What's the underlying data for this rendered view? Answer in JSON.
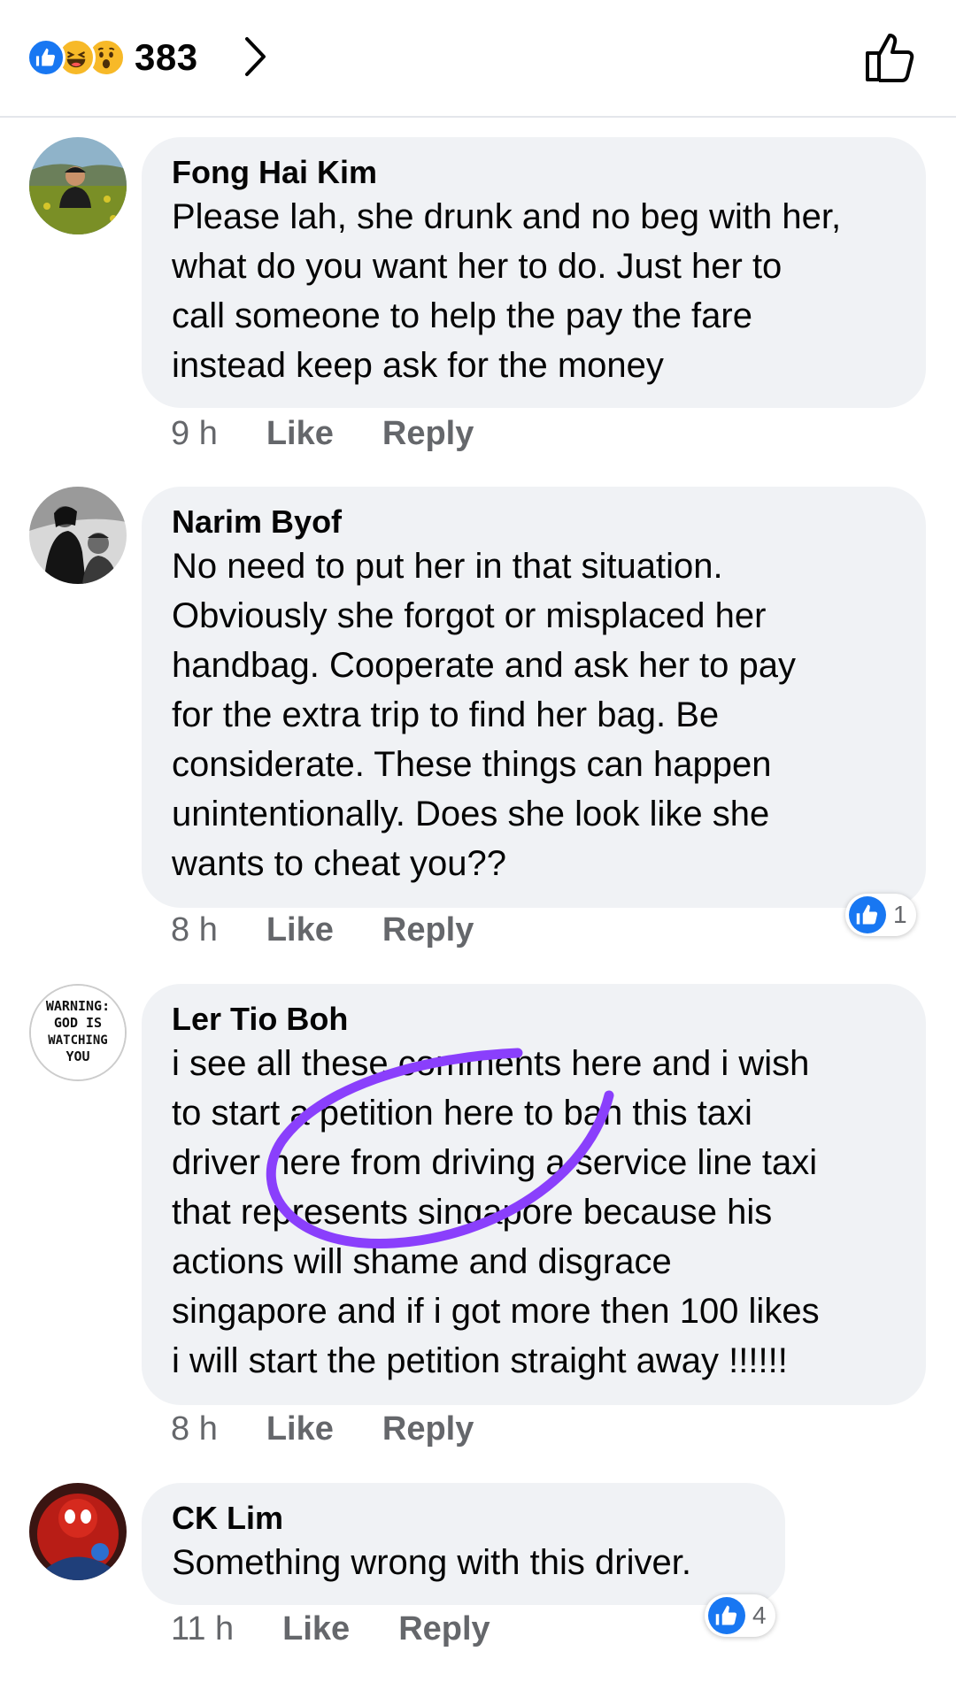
{
  "header": {
    "reaction_icons": [
      "like-reaction-icon",
      "haha-reaction-icon",
      "wow-reaction-icon"
    ],
    "reaction_count": "383"
  },
  "colors": {
    "like_blue": "#1877f2",
    "bubble_bg": "#f0f2f5",
    "meta_gray": "#65676b",
    "scribble_purple": "#8a3ffc"
  },
  "comments": [
    {
      "author": "Fong Hai Kim",
      "lines": [
        "Please lah, she drunk and no beg with her,",
        "what do you want her to do. Just her to",
        "call someone to help the pay the fare",
        "instead keep ask for the money"
      ],
      "time": "9 h",
      "like": "Like",
      "reply": "Reply"
    },
    {
      "author": "Narim Byof",
      "lines": [
        "No need to put her in that situation.",
        "Obviously she forgot or misplaced her",
        "handbag. Cooperate and ask her to pay",
        "for the extra trip to find her bag. Be",
        "considerate. These things can happen",
        "unintentionally. Does she look like she",
        "wants to cheat you??"
      ],
      "time": "8 h",
      "like": "Like",
      "reply": "Reply",
      "reaction_count": "1"
    },
    {
      "author": "Ler Tio Boh",
      "avatar_text": [
        "WARNING:",
        "GOD IS",
        "WATCHING",
        "YOU"
      ],
      "lines": [
        "i see all these comments here and i wish",
        "to start a petition here to ban this taxi",
        "driver here from driving a service line taxi",
        "that represents singapore because his",
        "actions will shame and disgrace",
        "singapore and if i got more then 100 likes",
        "i will start the petition straight away !!!!!!"
      ],
      "time": "8 h",
      "like": "Like",
      "reply": "Reply"
    },
    {
      "author": "CK Lim",
      "lines": [
        "Something wrong with this driver."
      ],
      "time": "11 h",
      "like": "Like",
      "reply": "Reply",
      "reaction_count": "4"
    }
  ]
}
